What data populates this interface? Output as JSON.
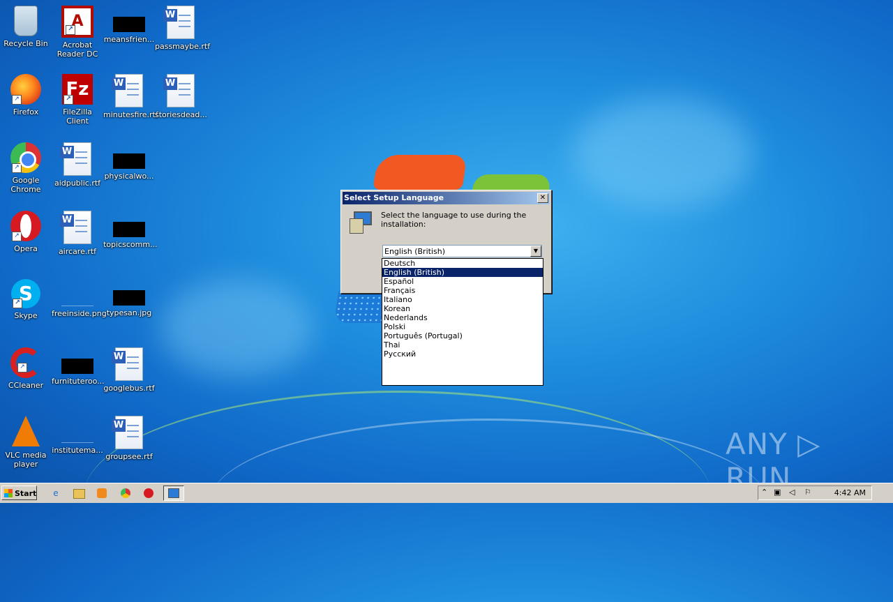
{
  "desktop": {
    "icons": [
      {
        "label": "Recycle Bin"
      },
      {
        "label": "Acrobat\nReader DC"
      },
      {
        "label": "meansfrien..."
      },
      {
        "label": "passmaybe.rtf"
      },
      {
        "label": "Firefox"
      },
      {
        "label": "FileZilla Client"
      },
      {
        "label": "minutesfire.rtf"
      },
      {
        "label": "storiesdead..."
      },
      {
        "label": "Google\nChrome"
      },
      {
        "label": "aidpublic.rtf"
      },
      {
        "label": "physicalwo..."
      },
      {
        "label": "Opera"
      },
      {
        "label": "aircare.rtf"
      },
      {
        "label": "topicscomm..."
      },
      {
        "label": "Skype"
      },
      {
        "label": "freeinside.png"
      },
      {
        "label": "typesan.jpg"
      },
      {
        "label": "CCleaner"
      },
      {
        "label": "furnituteroo..."
      },
      {
        "label": "googlebus.rtf"
      },
      {
        "label": "VLC media\nplayer"
      },
      {
        "label": "institutema..."
      },
      {
        "label": "groupsee.rtf"
      }
    ]
  },
  "dialog": {
    "title": "Select Setup Language",
    "close_label": "✕",
    "prompt": "Select the language to use during the installation:",
    "selected_value": "English (British)",
    "options": [
      "Deutsch",
      "English (British)",
      "Español",
      "Français",
      "Italiano",
      "Korean",
      "Nederlands",
      "Polski",
      "Português (Portugal)",
      "Thai",
      "Русский"
    ]
  },
  "watermark": "ANY ▷ RUN",
  "taskbar": {
    "start_label": "Start",
    "clock": "4:42 AM"
  },
  "colors": {
    "titlebar_start": "#0a246a",
    "titlebar_end": "#a6caf0",
    "selection": "#0a246a"
  }
}
